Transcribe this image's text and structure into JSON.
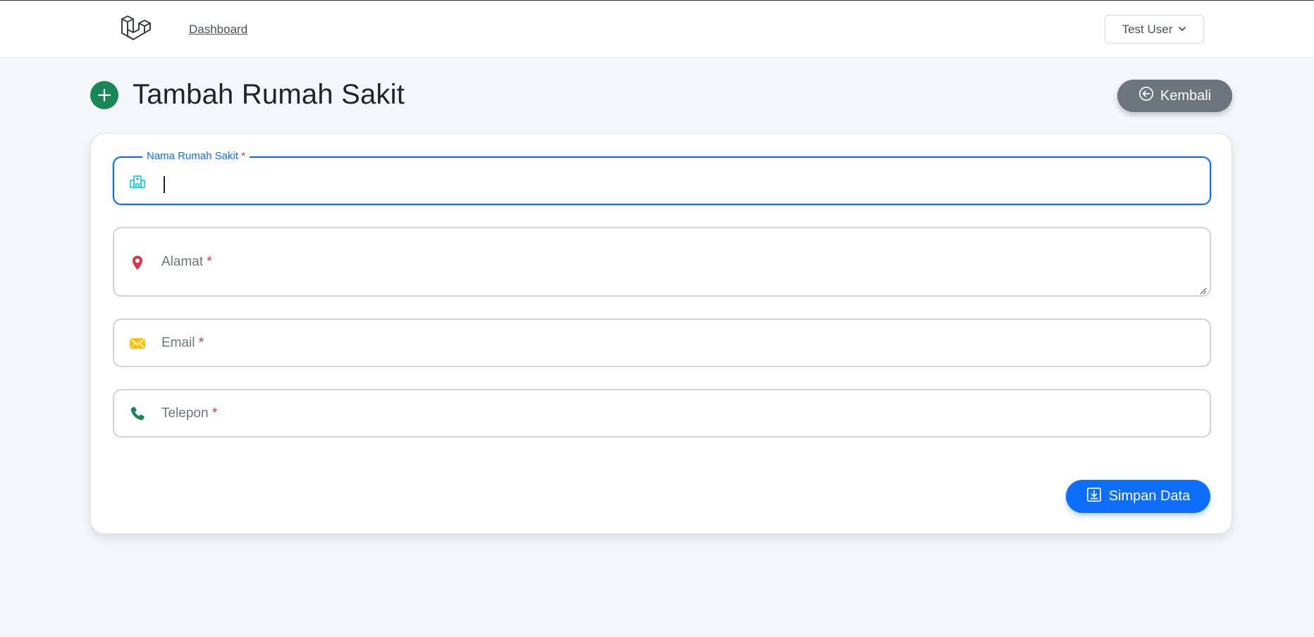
{
  "nav": {
    "logo_icon": "laravel-logo-icon",
    "links": [
      {
        "label": "Dashboard"
      }
    ],
    "user": {
      "name": "Test User",
      "icon": "chevron-down-icon"
    }
  },
  "page": {
    "title": "Tambah Rumah Sakit",
    "title_icon": "plus-circle-icon",
    "back_button": {
      "label": "Kembali",
      "icon": "arrow-left-circle-icon"
    }
  },
  "form": {
    "fields": [
      {
        "label": "Nama Rumah Sakit",
        "required_mark": "*",
        "value": "",
        "icon": "hospital-icon",
        "icon_color": "#0dcaf0",
        "state": "focused"
      },
      {
        "label": "Alamat",
        "required_mark": "*",
        "value": "",
        "icon": "map-pin-icon",
        "icon_color": "#dc3545"
      },
      {
        "label": "Email",
        "required_mark": "*",
        "value": "",
        "icon": "envelope-icon",
        "icon_color": "#ffc107"
      },
      {
        "label": "Telepon",
        "required_mark": "*",
        "value": "",
        "icon": "phone-icon",
        "icon_color": "#198754"
      }
    ],
    "submit": {
      "label": "Simpan Data",
      "icon": "download-box-icon"
    }
  },
  "colors": {
    "primary": "#0d6efd",
    "secondary": "#6c757d",
    "success": "#198754",
    "danger": "#dc3545"
  }
}
